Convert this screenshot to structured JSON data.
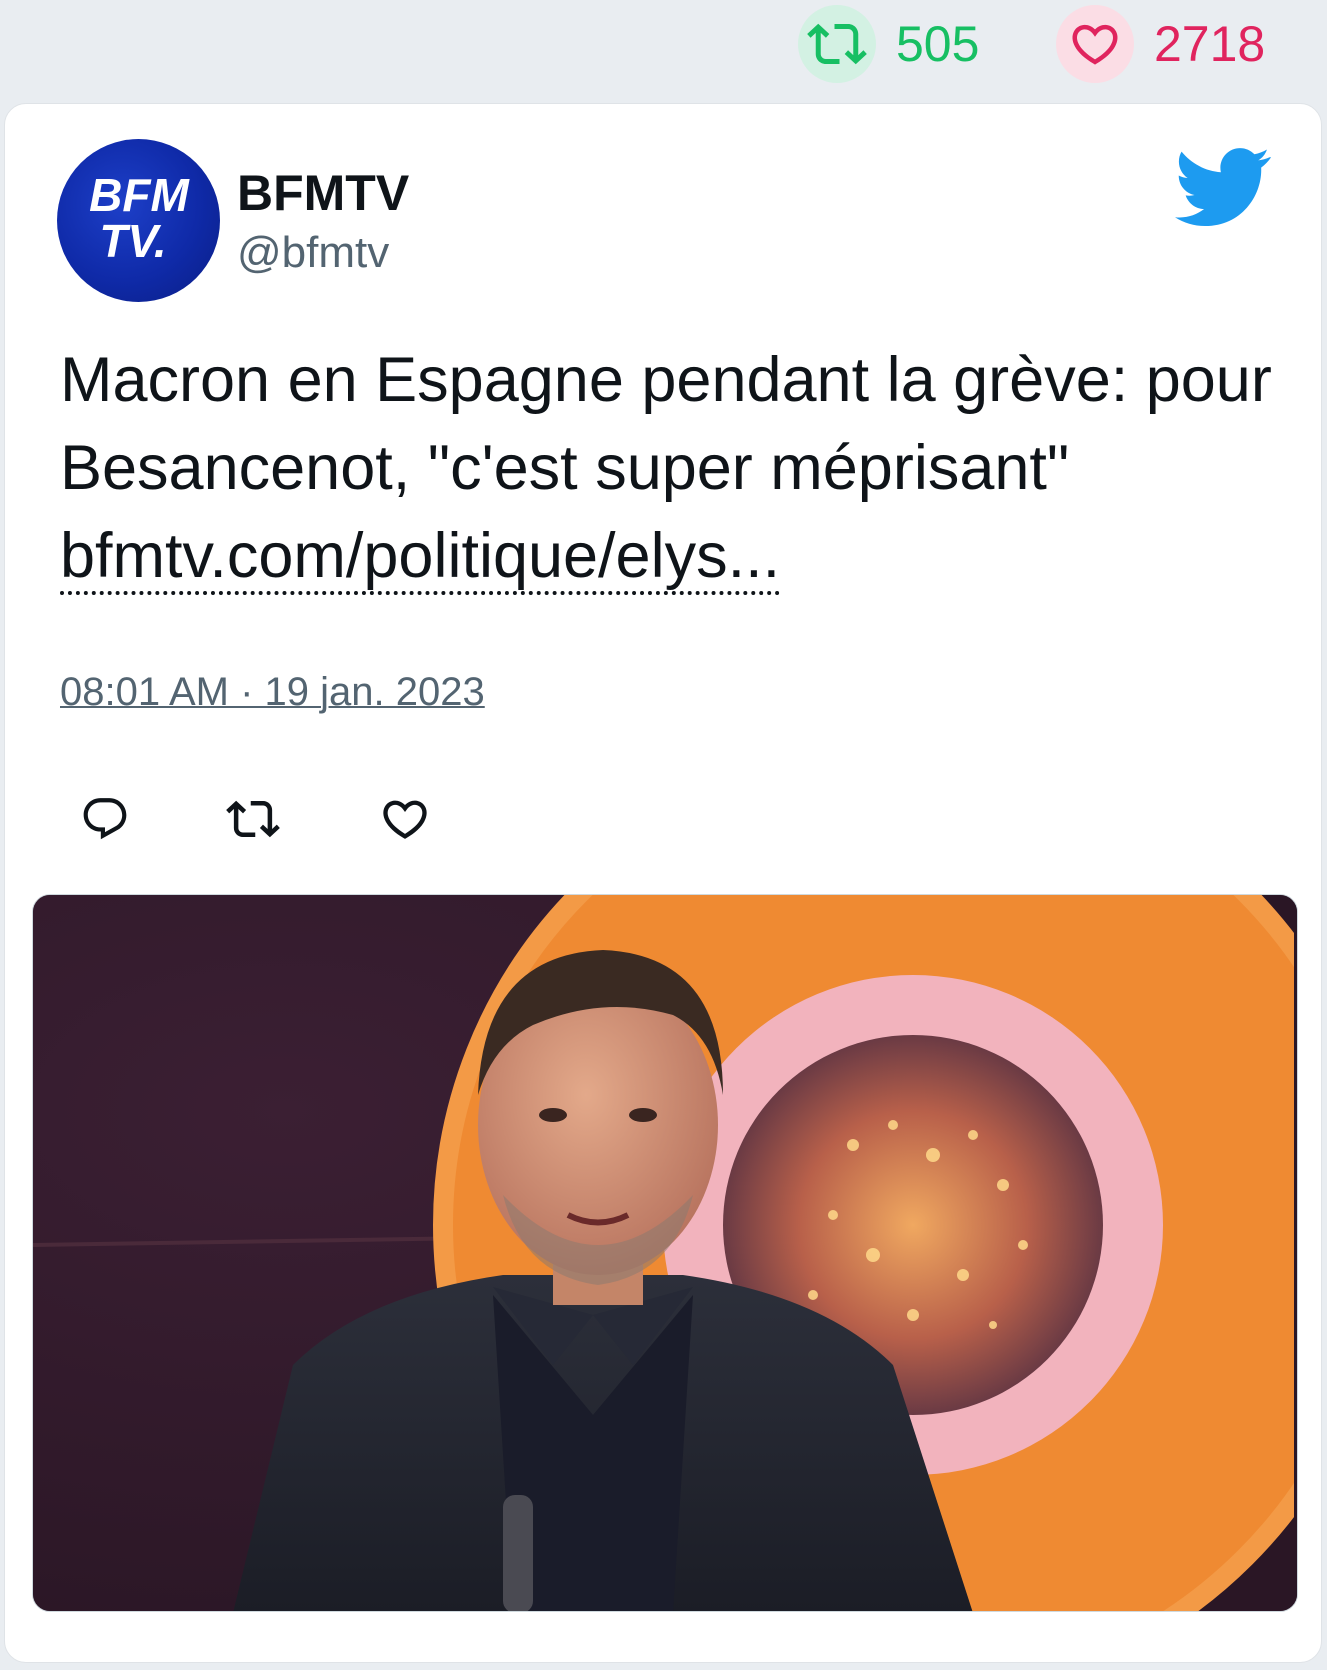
{
  "stats": {
    "retweets": "505",
    "likes": "2718",
    "retweet_icon": "retweet-icon",
    "like_icon": "heart-icon",
    "retweet_color": "#17bf63",
    "like_color": "#e0245e"
  },
  "tweet": {
    "avatar_logo_line1": "BFM",
    "avatar_logo_line2": "TV.",
    "display_name": "BFMTV",
    "handle": "@bfmtv",
    "text": "Macron en Espagne pendant la grève: pour Besancenot, \"c'est super méprisant\" ",
    "link_text": "bfmtv.com/politique/elys...",
    "timestamp": "08:01 AM · 19 jan. 2023"
  },
  "actions": {
    "reply_icon": "reply-icon",
    "retweet_icon": "retweet-icon",
    "like_icon": "heart-icon"
  },
  "colors": {
    "page_background": "#e9edf1",
    "card_background": "#ffffff",
    "twitter_blue": "#1d9bf0",
    "text_primary": "#0f1419",
    "text_secondary": "#536471"
  }
}
